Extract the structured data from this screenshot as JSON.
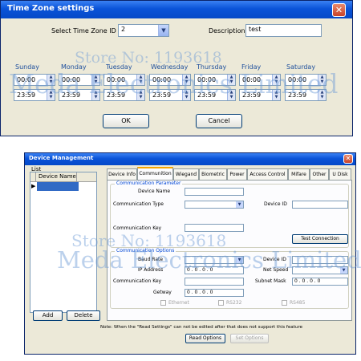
{
  "timezone_dialog": {
    "title": "Time Zone settings",
    "close_glyph": "✕",
    "id_label": "Select Time Zone ID",
    "id_value": "2",
    "description_label": "Description",
    "description_value": "test",
    "days": [
      "Sunday",
      "Monday",
      "Tuesday",
      "Wednesday",
      "Thursday",
      "Friday",
      "Saturday"
    ],
    "start_time": "00:00",
    "end_time": "23:59",
    "ok_label": "OK",
    "cancel_label": "Cancel"
  },
  "device_dialog": {
    "title": "Device Management",
    "close_glyph": "✕",
    "list_group_label": "List",
    "list_column": "Device Name",
    "add_label": "Add",
    "delete_label": "Delete",
    "tabs": [
      "Device Info",
      "Communition",
      "Wiegand",
      "Biometric",
      "Power",
      "Access Control",
      "Mifare",
      "Other",
      "U Disk"
    ],
    "comm_param_caption": "Communication Parameter",
    "device_name_label": "Device Name",
    "comm_type_label": "Communication Type",
    "device_id_label": "Device ID",
    "comm_key_label": "Communication Key",
    "test_button": "Test Connection",
    "comm_options_caption": "Communication Options",
    "baud_rate_label": "Baud Rate",
    "ip_address_label": "IP Address",
    "ip_address_value": "0  .  0  .  0  .  0",
    "comm_key2_label": "Communication Key",
    "gateway_label": "Getway",
    "gateway_value": "0  .  0  .  0  .  0",
    "device_id2_label": "Device ID",
    "net_speed_label": "Net Speed",
    "subnet_label": "Subnet Mask",
    "subnet_value": "0  .  0  .  0  .  0",
    "ethernet_label": "Ethernet",
    "rs232_label": "RS232",
    "rs485_label": "RS485",
    "note": "Note: When the \"Read Settings\" can not be edited after that does not support this feature",
    "read_options": "Read Options",
    "set_options": "Set Options"
  },
  "watermark": {
    "store_text_1": "Store No: 1193618",
    "company_text_1": "Meda Electronics Limited",
    "store_text_2": "Store No: 1193618",
    "company_text_2": "Meda Electronics Limited"
  },
  "icons": {
    "dropdown_arrow": "▼",
    "spin_up": "▲",
    "spin_down": "▼",
    "row_pointer": "▶"
  },
  "colors": {
    "titlebar": "#0a53d8",
    "dialog_bg": "#ece9d8",
    "day_label": "#1e4f9c",
    "group_caption": "#0046d5",
    "selection": "#316ac5",
    "watermark": "#6c9ad6"
  }
}
